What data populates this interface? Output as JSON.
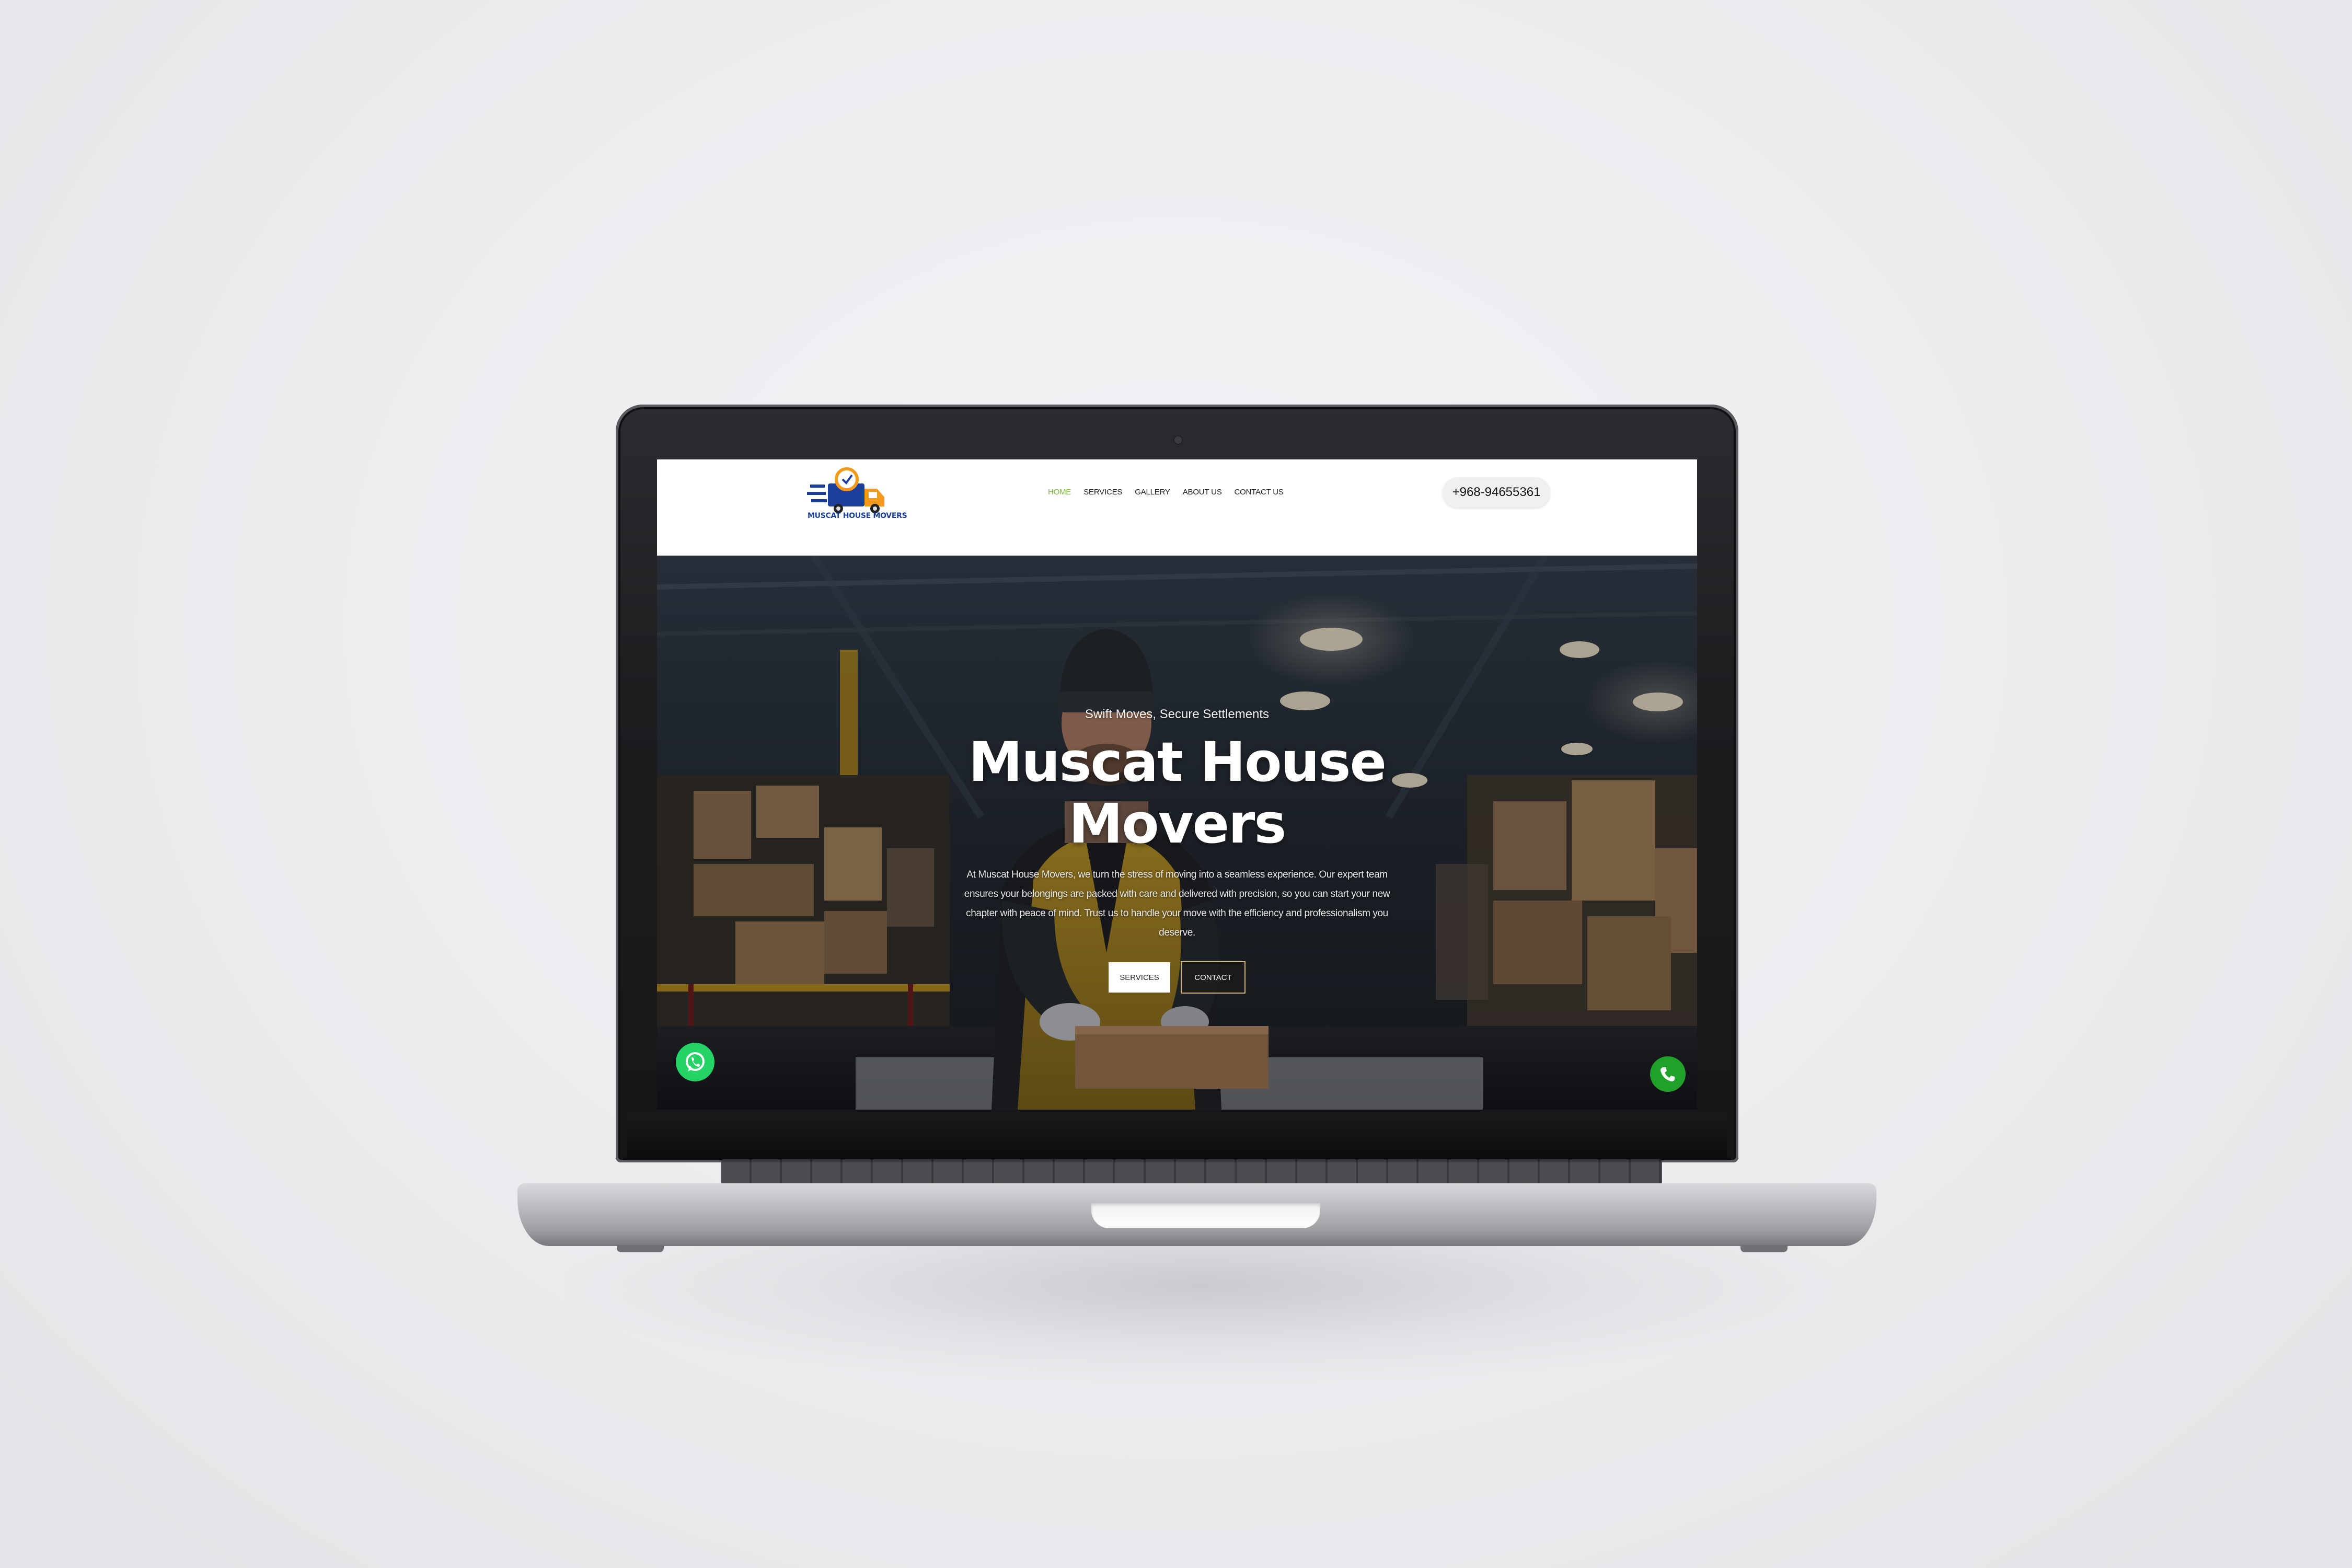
{
  "site": {
    "logo_text": "MUSCAT HOUSE MOVERS",
    "nav": [
      "HOME",
      "SERVICES",
      "GALLERY",
      "ABOUT US",
      "CONTACT US"
    ],
    "active_nav": "HOME",
    "phone": "+968-94655361"
  },
  "hero": {
    "tagline": "Swift Moves, Secure Settlements",
    "title_line1": "Muscat House",
    "title_line2": "Movers",
    "description": "At Muscat House Movers, we turn the stress of moving into a seamless experience. Our expert team ensures your belongings are packed with care and delivered with precision, so you can start your new chapter with peace of mind. Trust us to handle your move with the efficiency and professionalism you deserve.",
    "services_button": "SERVICES",
    "contact_button": "CONTACT"
  },
  "icons": {
    "floating_left": "whatsapp-icon",
    "floating_right": "phone-call-icon"
  },
  "colors": {
    "nav_active": "#7db63a",
    "logo_blue": "#1d3f9c",
    "logo_orange": "#f39a1c",
    "whatsapp_green": "#25d366",
    "call_green": "#1fa12a",
    "contact_border": "#d2b47a"
  }
}
